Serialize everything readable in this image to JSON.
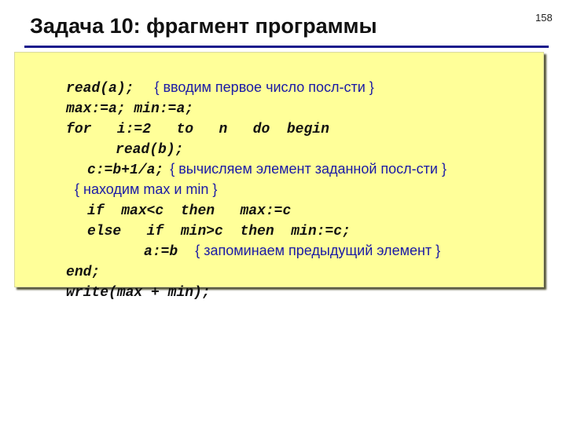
{
  "slide": {
    "title": "Задача 10: фрагмент программы",
    "page_number": "158"
  },
  "colors": {
    "title_rule": "#1a1a8c",
    "code_background": "#ffff99",
    "code_text": "#111111",
    "comment_text": "#1a1aa6"
  },
  "code": {
    "lines": [
      {
        "code": "read(a);",
        "comment": "{ вводим первое число посл-сти }"
      },
      {
        "code": "max:=a; min:=a;",
        "comment": ""
      },
      {
        "code": "for   i:=2   to   n   do  begin",
        "comment": ""
      },
      {
        "code": "read(b);",
        "comment": ""
      },
      {
        "code": "c:=b+1/a;",
        "comment": "{ вычисляем элемент заданной посл-сти }"
      },
      {
        "code": "",
        "comment": "{ находим max и min }"
      },
      {
        "code": "if  max<c  then   max:=c",
        "comment": ""
      },
      {
        "code": "else   if  min>c  then  min:=c;",
        "comment": ""
      },
      {
        "code": "a:=b",
        "comment": "{ запоминаем предыдущий элемент }"
      },
      {
        "code": "end;",
        "comment": ""
      },
      {
        "code": "write(max + min);",
        "comment": ""
      }
    ]
  }
}
